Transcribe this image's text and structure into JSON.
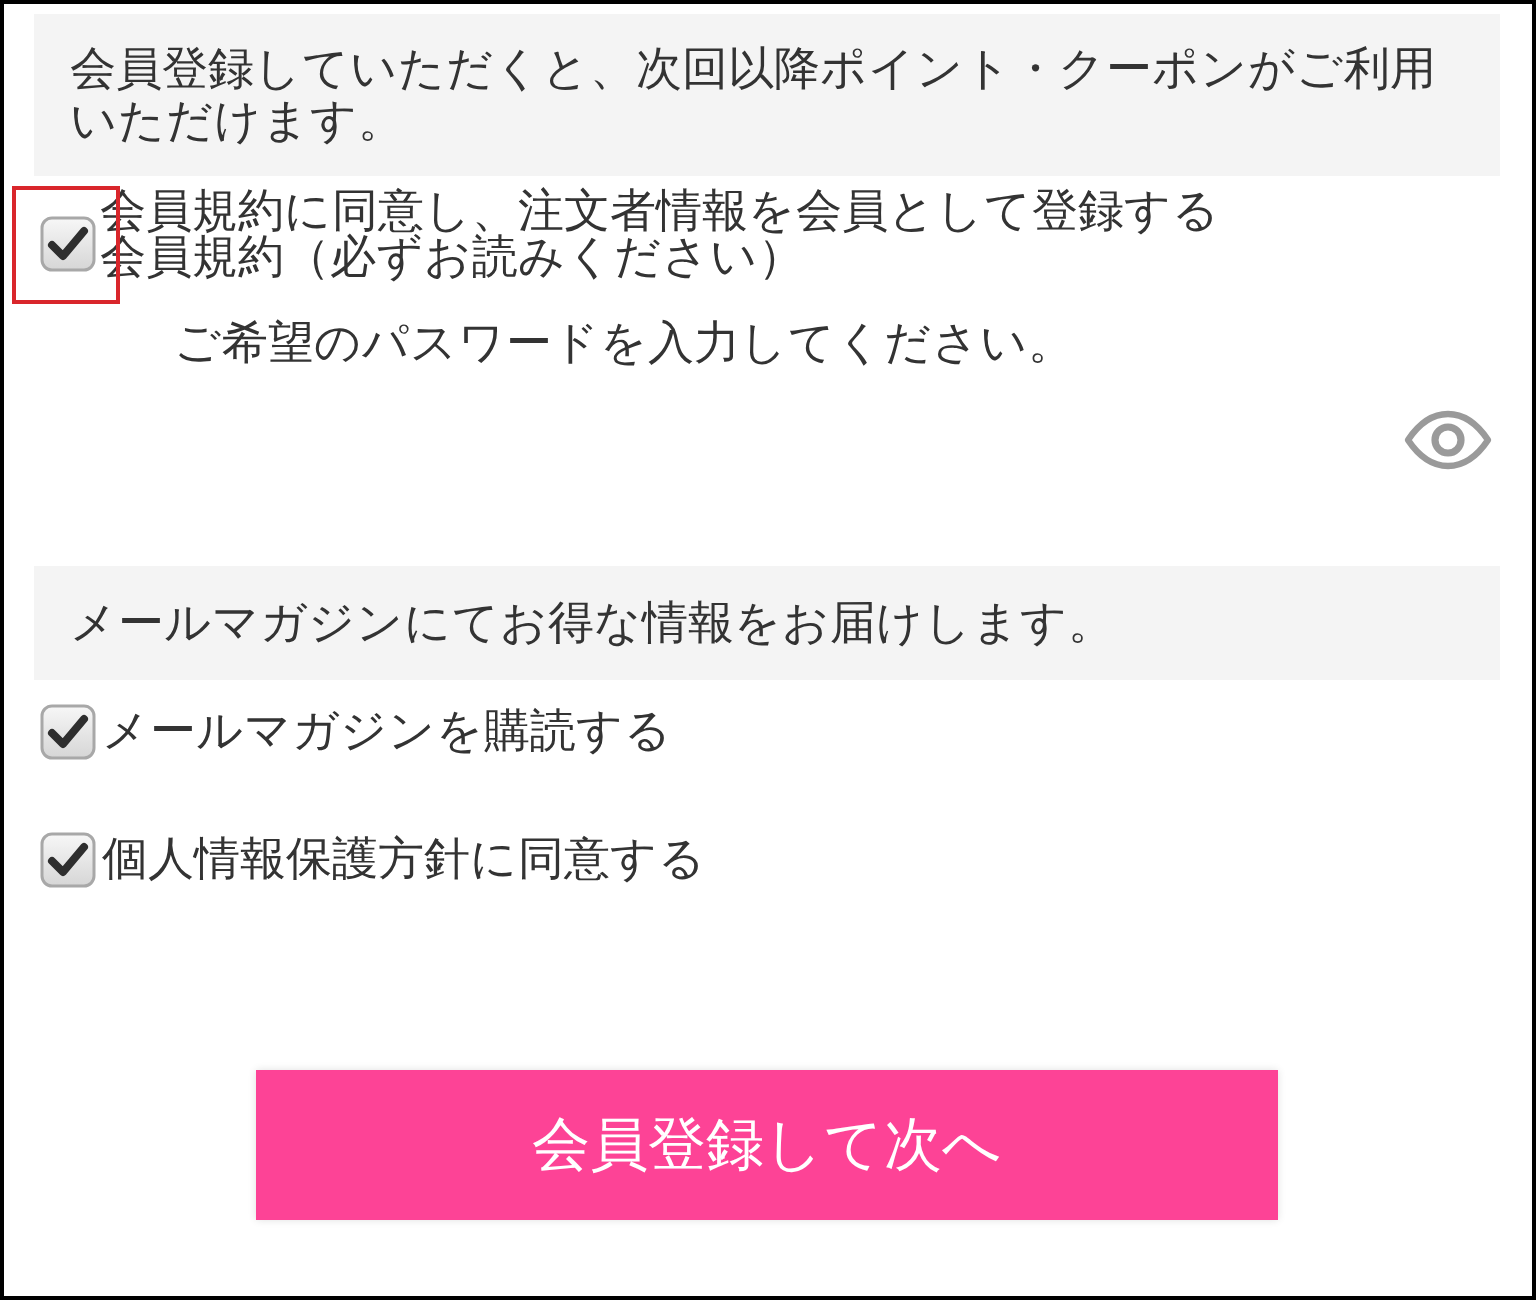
{
  "member_notice": {
    "text": "会員登録していただくと、次回以降ポイント・クーポンがご利用いただけます。"
  },
  "terms_checkbox": {
    "label": "会員規約に同意し、注文者情報を会員として登録する",
    "note": "会員規約（必ずお読みください）",
    "checked": true,
    "highlighted": true
  },
  "password": {
    "prompt": "ご希望のパスワードを入力してください。"
  },
  "newsletter_notice": {
    "text": "メールマガジンにてお得な情報をお届けします。"
  },
  "options": [
    {
      "label": "メールマガジンを購読する",
      "checked": true
    },
    {
      "label": "個人情報保護方針に同意する",
      "checked": true
    }
  ],
  "submit_button": {
    "label": "会員登録して次へ"
  }
}
